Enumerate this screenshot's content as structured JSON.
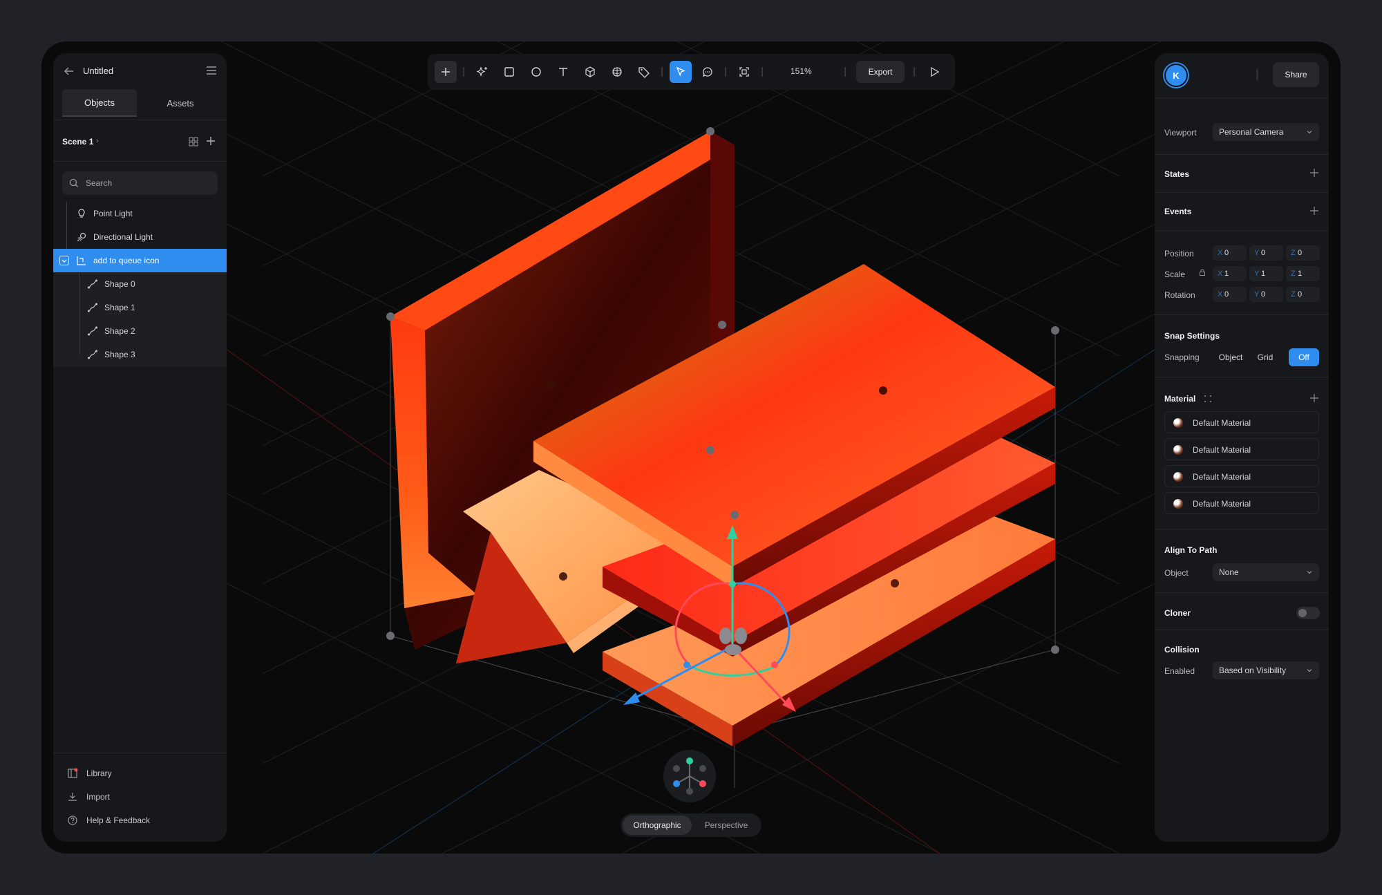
{
  "left_panel": {
    "title": "Untitled",
    "tabs": [
      "Objects",
      "Assets"
    ],
    "scene": "Scene 1",
    "search_placeholder": "Search",
    "tree": [
      {
        "label": "Point Light",
        "icon": "bulb-icon"
      },
      {
        "label": "Directional Light",
        "icon": "directional-light-icon"
      },
      {
        "label": "add to queue icon",
        "icon": "group-icon",
        "selected": true
      },
      {
        "label": "Shape 0",
        "icon": "path-icon"
      },
      {
        "label": "Shape 1",
        "icon": "path-icon"
      },
      {
        "label": "Shape 2",
        "icon": "path-icon"
      },
      {
        "label": "Shape 3",
        "icon": "path-icon"
      }
    ],
    "footer": [
      {
        "label": "Library",
        "icon": "library-icon"
      },
      {
        "label": "Import",
        "icon": "import-icon"
      },
      {
        "label": "Help & Feedback",
        "icon": "help-icon"
      }
    ]
  },
  "toolbar": {
    "zoom": "151%",
    "export_label": "Export",
    "tools": [
      "add",
      "sparkle",
      "rectangle",
      "ellipse",
      "text",
      "cube",
      "sphere",
      "tag",
      "select",
      "comment",
      "frame",
      "play"
    ]
  },
  "right_panel": {
    "avatar_initial": "K",
    "share_label": "Share",
    "viewport_label": "Viewport",
    "viewport_value": "Personal Camera",
    "states_label": "States",
    "events_label": "Events",
    "transform": {
      "position_label": "Position",
      "scale_label": "Scale",
      "rotation_label": "Rotation",
      "position": {
        "X": "0",
        "Y": "0",
        "Z": "0"
      },
      "scale": {
        "X": "1",
        "Y": "1",
        "Z": "1"
      },
      "rotation": {
        "X": "0",
        "Y": "0",
        "Z": "0"
      }
    },
    "snap_label": "Snap Settings",
    "snapping_label": "Snapping",
    "snapping_options": [
      "Object",
      "Grid",
      "Off"
    ],
    "snapping_selected": "Off",
    "material_label": "Material",
    "materials": [
      "Default Material",
      "Default Material",
      "Default Material",
      "Default Material"
    ],
    "align_label": "Align To Path",
    "align_object_label": "Object",
    "align_object_value": "None",
    "cloner_label": "Cloner",
    "cloner_on": false,
    "collision_label": "Collision",
    "collision_enabled_label": "Enabled",
    "collision_enabled_value": "Based on Visibility"
  },
  "view": {
    "modes": [
      "Orthographic",
      "Perspective"
    ],
    "selected_mode": "Orthographic"
  },
  "colors": {
    "accent": "#2f8df0",
    "canvas": "#0a0a0b",
    "panel": "#17181b",
    "object_orange": "#ff7a2a",
    "object_red": "#ff2a12"
  }
}
